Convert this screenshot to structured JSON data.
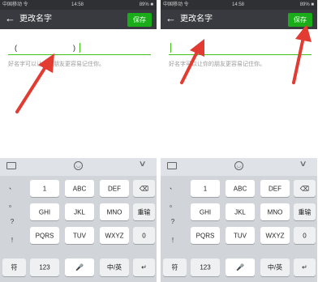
{
  "status": {
    "carrier": "中国移动 令",
    "time": "14:58",
    "battery": "89% ■"
  },
  "nav": {
    "back": "←",
    "title": "更改名字",
    "save": "保存"
  },
  "left_field": {
    "value_open": "(",
    "value_close": ")"
  },
  "hint": "好名字可以让你的朋友更容易记住你。",
  "keyboard": {
    "punct": [
      "、",
      "。",
      "?",
      "!"
    ],
    "row1": [
      "1",
      "ABC",
      "DEF",
      "⌫"
    ],
    "row2": [
      "GHI",
      "JKL",
      "MNO",
      "重输"
    ],
    "row3": [
      "PQRS",
      "TUV",
      "WXYZ",
      "0"
    ],
    "row4": [
      "符",
      "123",
      "🎤",
      "中/英",
      "↵"
    ]
  },
  "colors": {
    "save_green": "#1aad19",
    "arrow_red": "#e23b32",
    "navbar": "#393a3f"
  }
}
